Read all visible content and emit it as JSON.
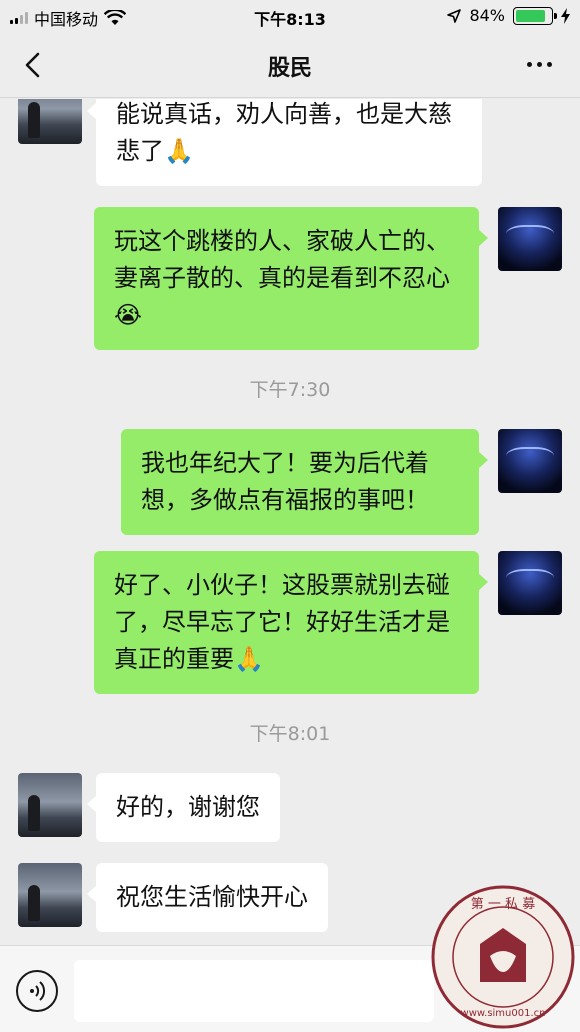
{
  "status_bar": {
    "carrier": "中国移动",
    "time": "下午8:13",
    "battery_percent": "84%",
    "battery_level": 0.84,
    "signal_bars_active": 2,
    "signal_bars_total": 4,
    "icons": [
      "signal-icon",
      "wifi-icon",
      "location-arrow-icon",
      "battery-icon",
      "charging-bolt-icon"
    ]
  },
  "nav": {
    "title": "股民",
    "back_icon": "chevron-left-icon",
    "more_icon": "more-dots-icon"
  },
  "messages": [
    {
      "sender": "other",
      "text": "能说真话，劝人向善，也是大慈悲了🙏"
    },
    {
      "sender": "self",
      "text": "玩这个跳楼的人、家破人亡的、妻离子散的、真的是看到不忍心😭"
    },
    {
      "type": "time",
      "text": "下午7:30"
    },
    {
      "sender": "self",
      "text": "我也年纪大了！要为后代着想，多做点有福报的事吧！"
    },
    {
      "sender": "self",
      "text": "好了、小伙子！这股票就别去碰了，尽早忘了它！好好生活才是真正的重要🙏"
    },
    {
      "type": "time",
      "text": "下午8:01"
    },
    {
      "sender": "other",
      "text": "好的，谢谢您"
    },
    {
      "sender": "other",
      "text": "祝您生活愉快开心"
    }
  ],
  "input_bar": {
    "voice_icon": "voice-input-icon",
    "input_value": ""
  },
  "watermark": {
    "text_top": "第 一 私 募",
    "text_bottom": "www.simu001.cn"
  },
  "colors": {
    "background": "#ededed",
    "self_bubble": "#95ec69",
    "other_bubble": "#ffffff",
    "battery_green": "#35c759",
    "timestamp_text": "#9a9a9a",
    "watermark_red": "#8e2a35"
  }
}
